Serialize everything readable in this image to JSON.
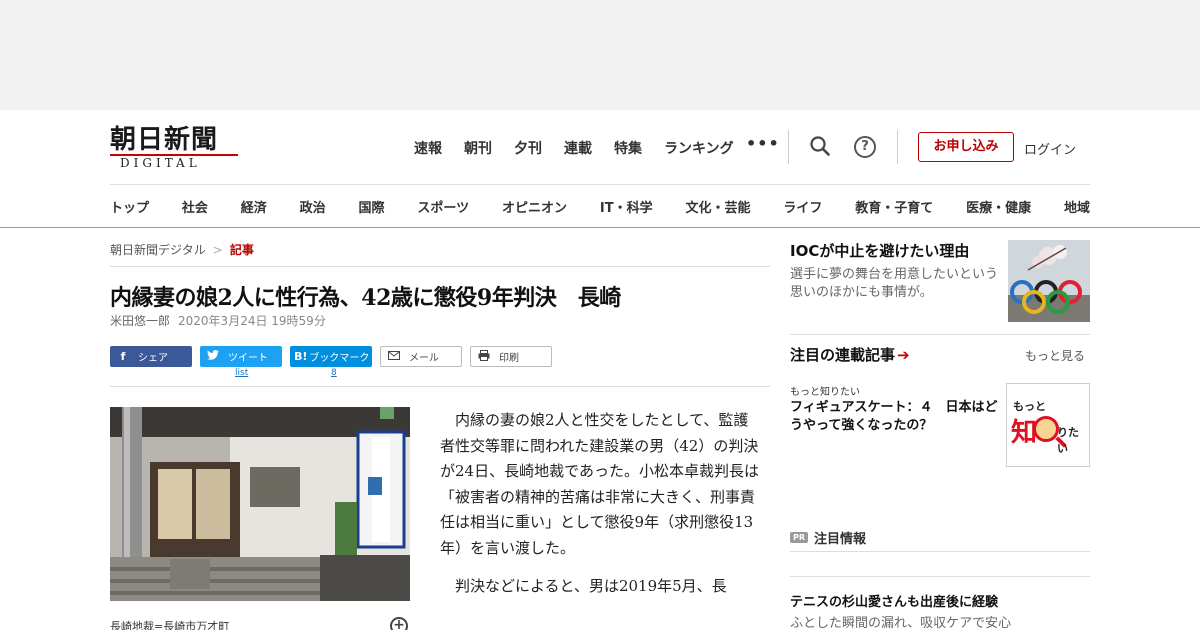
{
  "header": {
    "logo_main": "朝日新聞",
    "logo_sub": "DIGITAL",
    "top_nav": [
      "速報",
      "朝刊",
      "夕刊",
      "連載",
      "特集",
      "ランキング"
    ],
    "more": "•••",
    "help_label": "?",
    "signup_label": "お申し込み",
    "login_label": "ログイン",
    "categories": [
      "トップ",
      "社会",
      "経済",
      "政治",
      "国際",
      "スポーツ",
      "オピニオン",
      "IT・科学",
      "文化・芸能",
      "ライフ",
      "教育・子育て",
      "医療・健康",
      "地域"
    ]
  },
  "breadcrumb": {
    "home": "朝日新聞デジタル",
    "separator": ">",
    "current": "記事"
  },
  "article": {
    "headline": "内縁妻の娘2人に性行為、42歳に懲役9年判決　長崎",
    "author": "米田悠一郎",
    "date": "2020年3月24日 19時59分",
    "share": {
      "facebook": "シェア",
      "twitter": "ツイート",
      "hatena": "ブックマーク",
      "mail": "メール",
      "print": "印刷",
      "twitter_count": "list",
      "hatena_count": "8"
    },
    "photo_caption": "長崎地裁=長崎市万才町",
    "paragraphs": [
      "内縁の妻の娘2人と性交をしたとして、監護者性交等罪に問われた建設業の男（42）の判決が24日、長崎地裁であった。小松本卓裁判長は「被害者の精神的苦痛は非常に大きく、刑事責任は相当に重い」として懲役9年（求刑懲役13年）を言い渡した。",
      "判決などによると、男は2019年5月、長"
    ]
  },
  "sidebar": {
    "top_title": "IOCが中止を避けたい理由",
    "top_sub": "選手に夢の舞台を用意したいという思いのほかにも事情が。",
    "series_heading": "注目の連載記事",
    "series_arrow": "➔",
    "more_link": "もっと見る",
    "series_label": "もっと知りたい",
    "series_title": "フィギュアスケート：４　日本はどうやって強くなったの？",
    "series_logo_top": "もっと",
    "series_logo_big": "知",
    "series_logo_rest": "りたい",
    "pr_badge": "PR",
    "pr_heading": "注目情報",
    "pr_title": "テニスの杉山愛さんも出産後に経験",
    "pr_sub": "ふとした瞬間の漏れ、吸収ケアで安心"
  },
  "colors": {
    "accent": "#bb0000",
    "facebook": "#3b5998",
    "twitter": "#1da1f2",
    "hatena": "#008fde"
  }
}
